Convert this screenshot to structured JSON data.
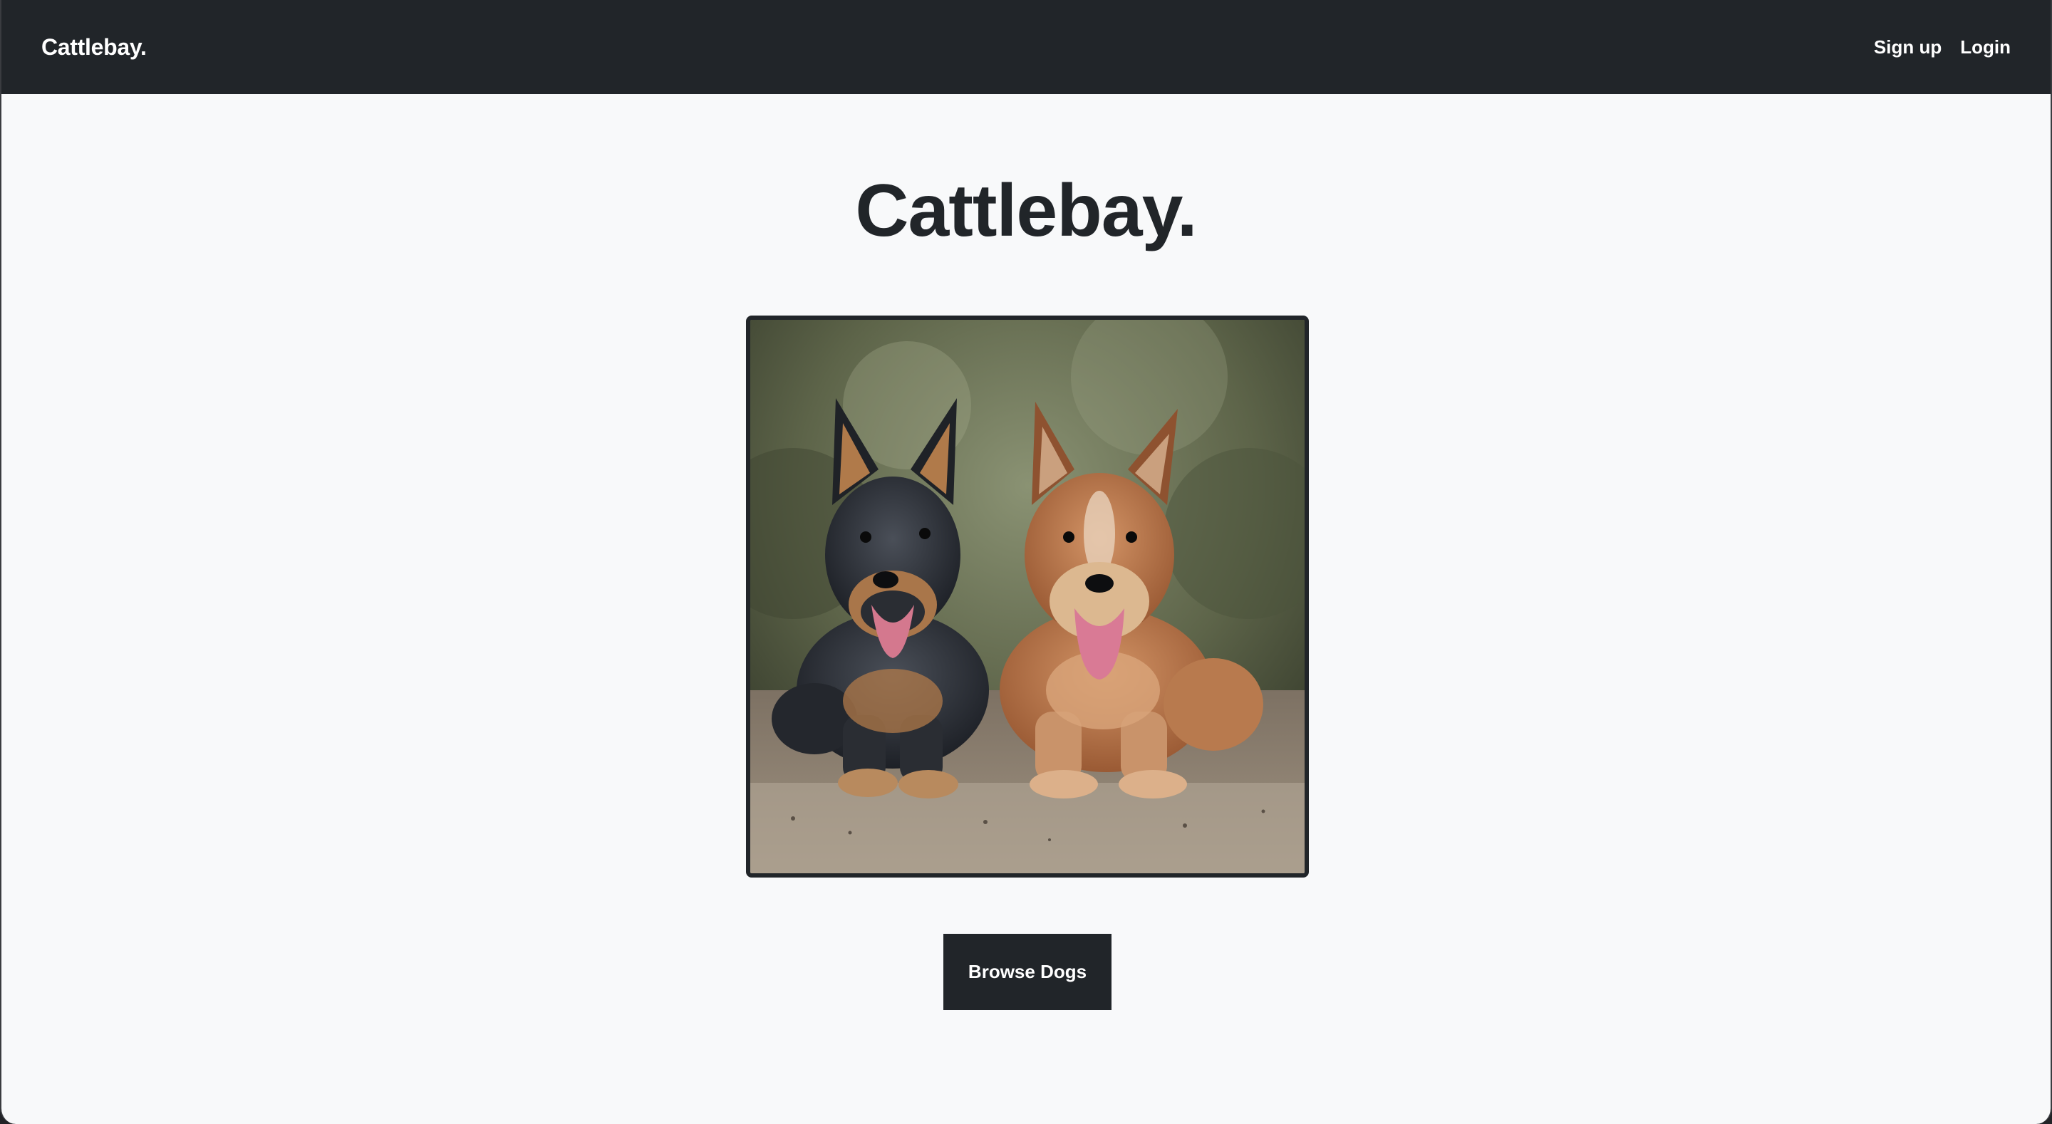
{
  "navbar": {
    "brand": "Cattlebay.",
    "links": [
      {
        "label": "Sign up"
      },
      {
        "label": "Login"
      }
    ]
  },
  "hero": {
    "title": "Cattlebay.",
    "image_subject": "two cattle dogs lying side by side"
  },
  "actions": {
    "browse_label": "Browse Dogs"
  },
  "colors": {
    "navbar_bg": "#212529",
    "page_bg": "#f8f9fa",
    "button_bg": "#212529",
    "text_dark": "#212529"
  }
}
